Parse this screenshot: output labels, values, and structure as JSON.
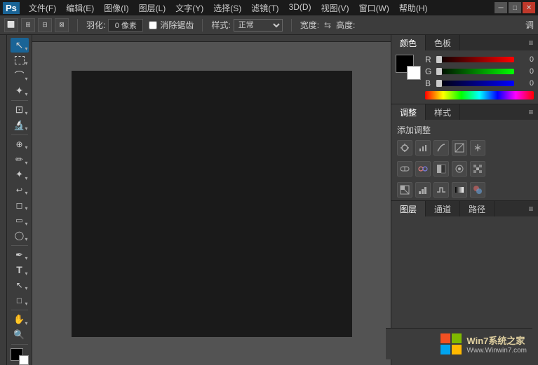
{
  "titlebar": {
    "logo": "Ps",
    "menus": [
      "文件(F)",
      "编辑(E)",
      "图像(I)",
      "图层(L)",
      "文字(Y)",
      "选择(S)",
      "滤镜(T)",
      "3D(D)",
      "视图(V)",
      "窗口(W)",
      "帮助(H)"
    ],
    "win_controls": [
      "─",
      "□",
      "✕"
    ]
  },
  "options_bar": {
    "feather_label": "羽化:",
    "feather_value": "0 像素",
    "anti_alias_label": "消除锯齿",
    "style_label": "样式:",
    "style_value": "正常",
    "width_label": "宽度:",
    "height_label": "高度:",
    "adjust_label": "调"
  },
  "color_panel": {
    "tabs": [
      "颜色",
      "色板"
    ],
    "r_label": "R",
    "g_label": "G",
    "b_label": "B",
    "r_value": "0",
    "g_value": "0",
    "b_value": "0"
  },
  "adjust_panel": {
    "tabs": [
      "调整",
      "样式"
    ],
    "add_label": "添加调整",
    "icons": [
      "☀",
      "▦",
      "☐",
      "☑",
      "▽",
      "☐",
      "△",
      "☐",
      "◈",
      "❃",
      "▦",
      "☐",
      "☐",
      "☐",
      "▦"
    ]
  },
  "layers_panel": {
    "tabs": [
      "图层",
      "通道",
      "路径"
    ]
  },
  "tools": [
    {
      "name": "move",
      "icon": "↖",
      "label": "移动工具"
    },
    {
      "name": "select-rect",
      "icon": "⬜",
      "label": "矩形选框"
    },
    {
      "name": "select-lasso",
      "icon": "⌒",
      "label": "套索工具"
    },
    {
      "name": "magic-wand",
      "icon": "✦",
      "label": "魔棒工具"
    },
    {
      "name": "crop",
      "icon": "⊡",
      "label": "裁剪工具"
    },
    {
      "name": "eyedropper",
      "icon": "✒",
      "label": "吸管工具"
    },
    {
      "name": "spot-heal",
      "icon": "⊕",
      "label": "污点修复"
    },
    {
      "name": "brush",
      "icon": "✏",
      "label": "画笔工具"
    },
    {
      "name": "clone-stamp",
      "icon": "✦",
      "label": "仿制图章"
    },
    {
      "name": "history-brush",
      "icon": "↩",
      "label": "历史记录画笔"
    },
    {
      "name": "eraser",
      "icon": "◻",
      "label": "橡皮擦"
    },
    {
      "name": "gradient",
      "icon": "▭",
      "label": "渐变工具"
    },
    {
      "name": "dodge",
      "icon": "◯",
      "label": "减淡工具"
    },
    {
      "name": "pen",
      "icon": "✒",
      "label": "钢笔工具"
    },
    {
      "name": "text",
      "icon": "T",
      "label": "文字工具"
    },
    {
      "name": "path-select",
      "icon": "↖",
      "label": "路径选择"
    },
    {
      "name": "shape",
      "icon": "□",
      "label": "形状工具"
    },
    {
      "name": "hand",
      "icon": "✋",
      "label": "抓手工具"
    },
    {
      "name": "zoom",
      "icon": "⊕",
      "label": "缩放工具"
    }
  ],
  "watermark": {
    "site": "Www.Winwin7.com",
    "text": "Win7系统之家"
  }
}
